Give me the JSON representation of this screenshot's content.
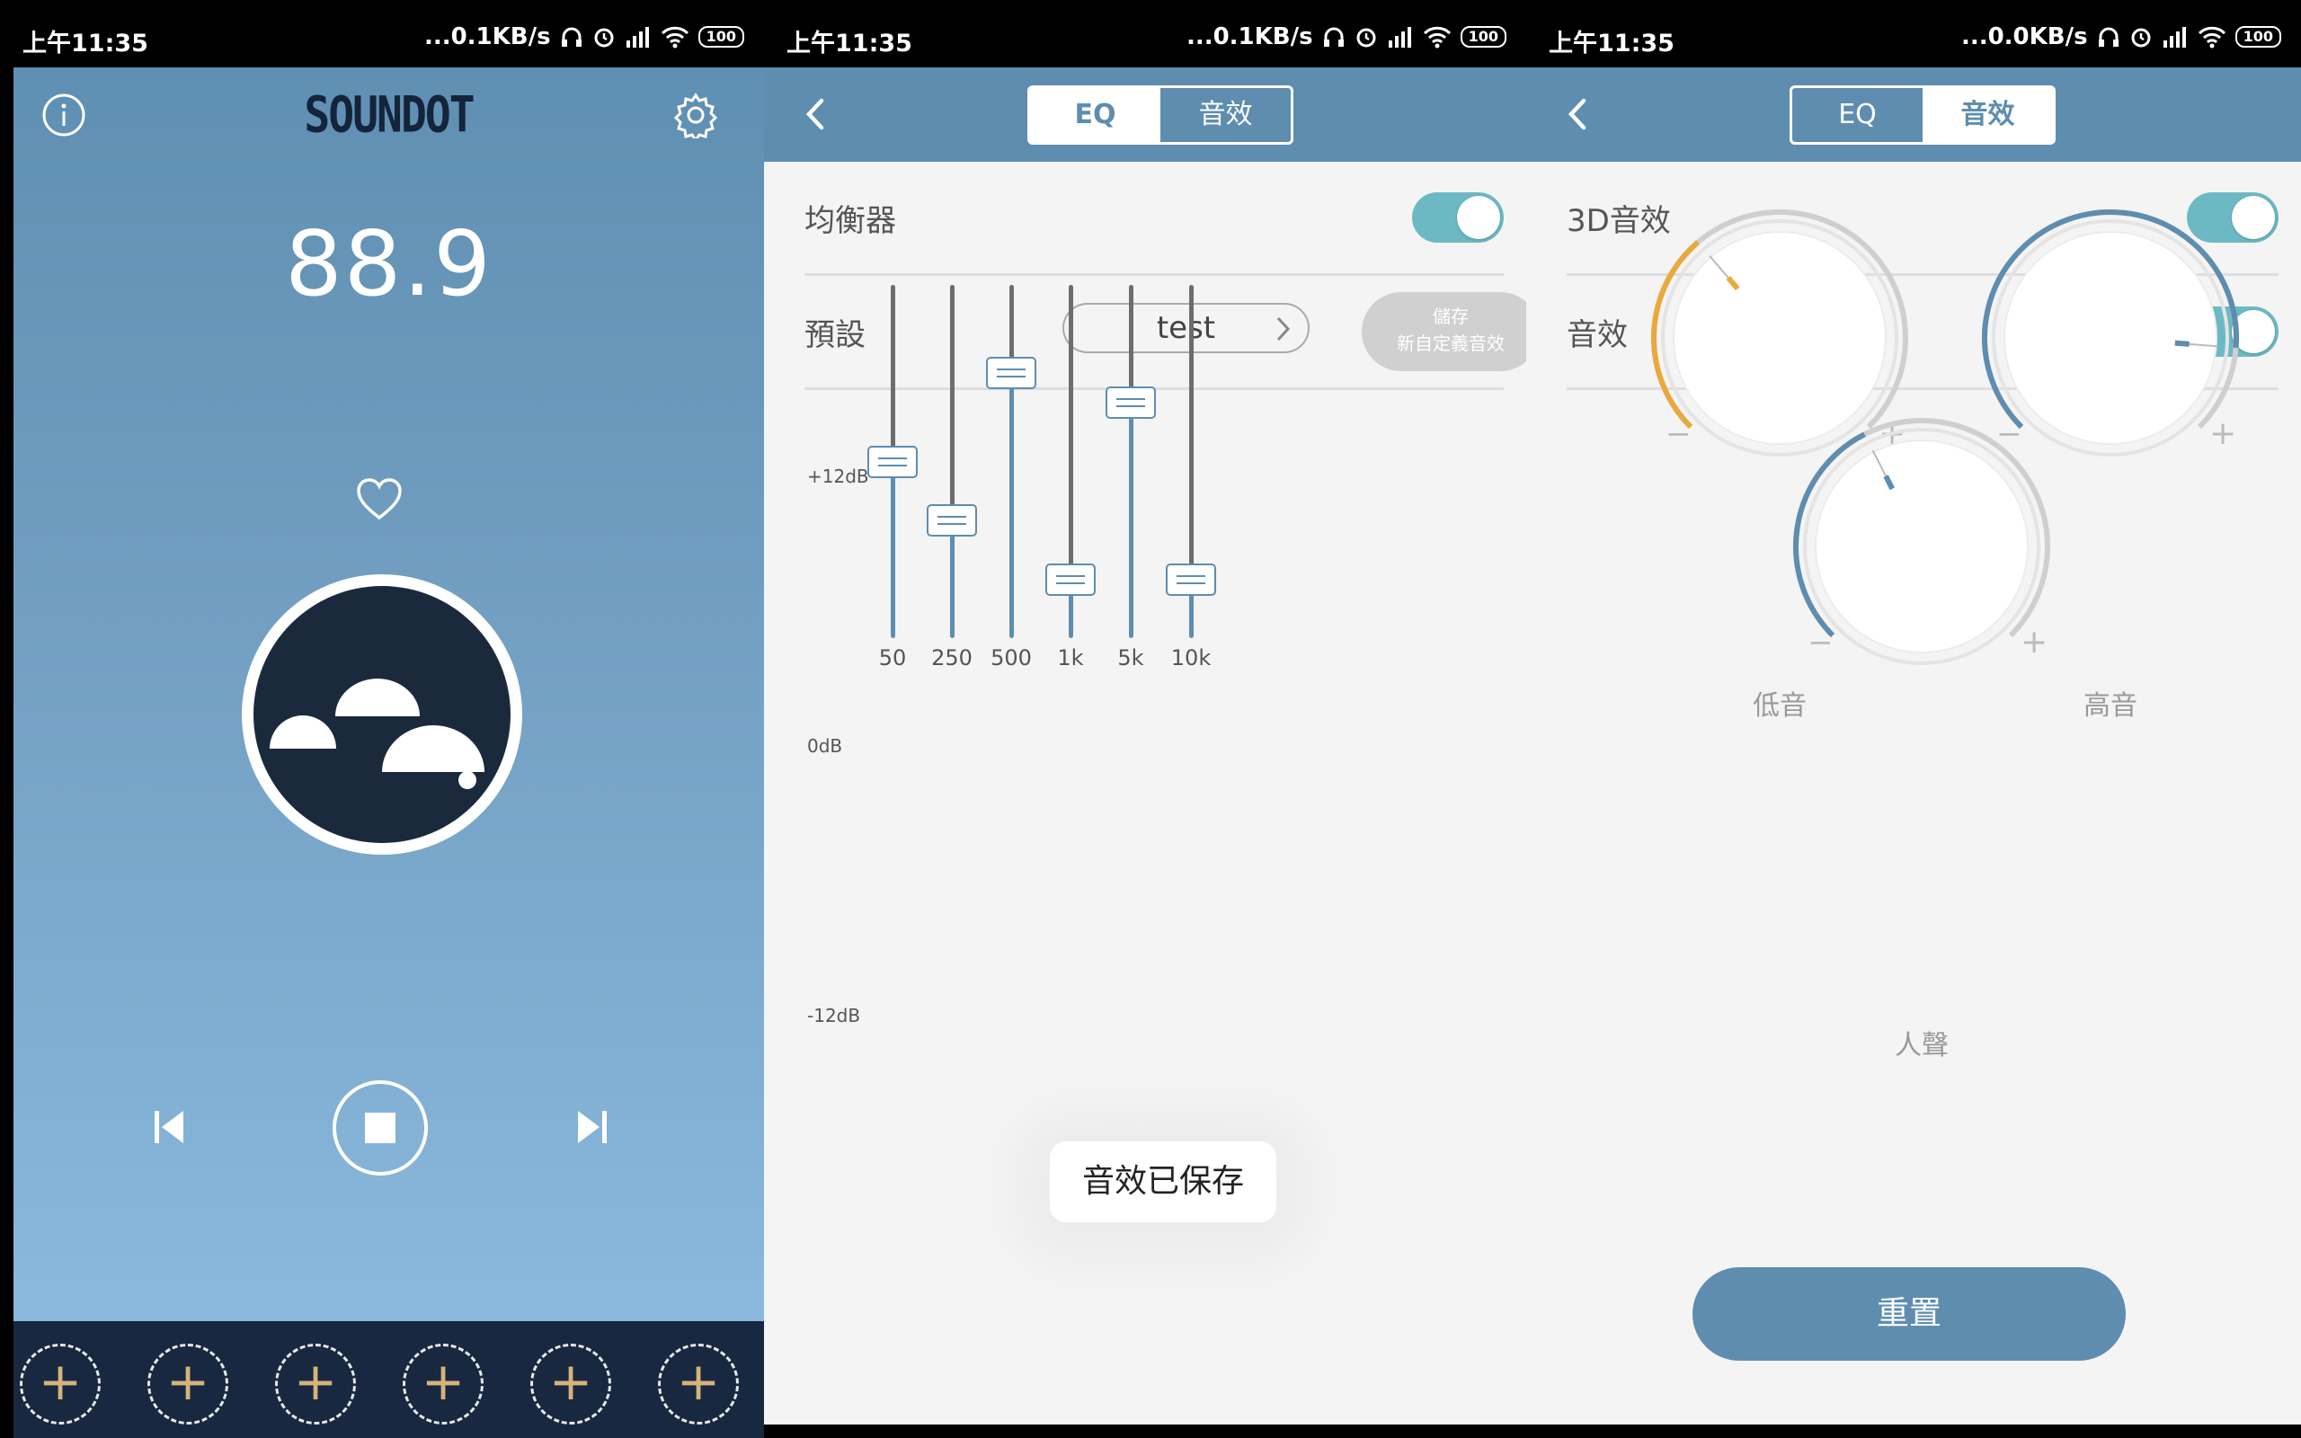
{
  "statusbars": [
    {
      "time": "上午11:35",
      "speed": "...0.1KB/s",
      "battery": "100"
    },
    {
      "time": "上午11:35",
      "speed": "...0.1KB/s",
      "battery": "100"
    },
    {
      "time": "上午11:35",
      "speed": "...0.0KB/s",
      "battery": "100"
    }
  ],
  "player": {
    "logo": "SOUNDOT",
    "frequency": "88.9",
    "preset_slots": [
      "+",
      "+",
      "+",
      "+",
      "+",
      "+"
    ],
    "colors": {
      "bottom_bar": "#182840",
      "slot_plus": "#d6b37a"
    }
  },
  "tabs": {
    "eq": "EQ",
    "effects": "音效"
  },
  "eq": {
    "equalizer_label": "均衡器",
    "equalizer_on": true,
    "preset_label": "預設",
    "preset_value": "test",
    "save_line1": "儲存",
    "save_line2": "新自定義音效",
    "db_top": "+12dB",
    "db_mid": "0dB",
    "db_bottom": "-12dB",
    "bands": [
      {
        "freq": "50",
        "gain_db": 0
      },
      {
        "freq": "250",
        "gain_db": -4
      },
      {
        "freq": "500",
        "gain_db": 6
      },
      {
        "freq": "1k",
        "gain_db": -8
      },
      {
        "freq": "5k",
        "gain_db": 4
      },
      {
        "freq": "10k",
        "gain_db": -8
      }
    ],
    "toast": "音效已保存"
  },
  "effects": {
    "three_d_label": "3D音效",
    "three_d_on": true,
    "effect_label": "音效",
    "effect_on": true,
    "bass_label": "低音",
    "treble_label": "高音",
    "vocal_label": "人聲",
    "minus": "−",
    "plus": "+",
    "knob_levels": {
      "bass": 0.35,
      "treble": 0.85,
      "vocal": 0.4
    },
    "reset_label": "重置"
  },
  "colors": {
    "header": "#5e8db0",
    "toggle_on": "#6cb9c4",
    "bass_arc": "#e9a93d",
    "arc_blue": "#5e8db0"
  }
}
